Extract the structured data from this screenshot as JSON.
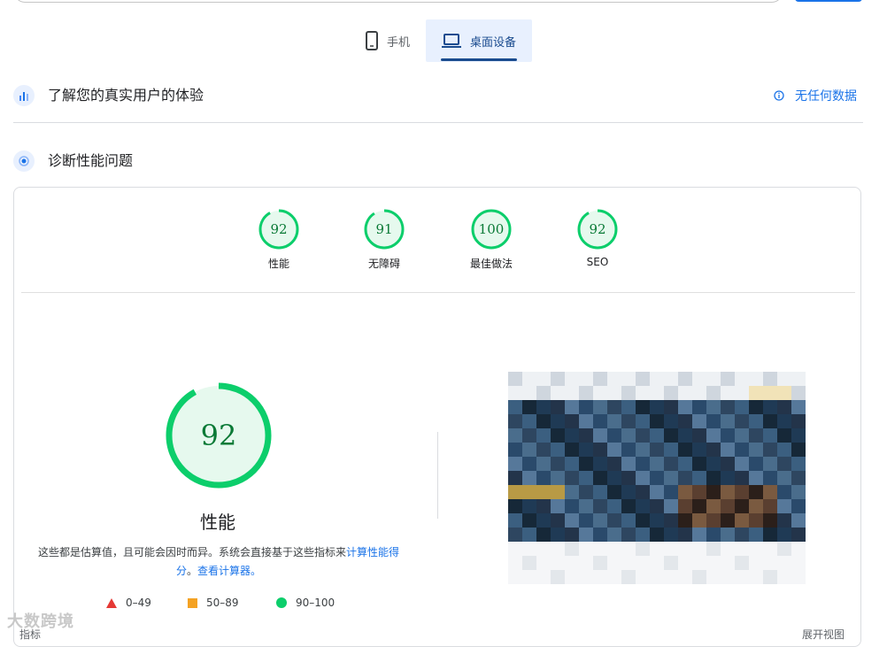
{
  "tabs": {
    "mobile": {
      "label": "手机",
      "icon": "smartphone-icon"
    },
    "desktop": {
      "label": "桌面设备",
      "icon": "laptop-icon"
    }
  },
  "crux": {
    "title": "了解您的真实用户的体验",
    "status": "无任何数据",
    "icon": "crux-chart-icon",
    "status_icon": "info-icon"
  },
  "diagnostics": {
    "title": "诊断性能问题",
    "icon": "lighthouse-icon"
  },
  "scores": [
    {
      "value": "92",
      "label": "性能"
    },
    {
      "value": "91",
      "label": "无障碍"
    },
    {
      "value": "100",
      "label": "最佳做法"
    },
    {
      "value": "92",
      "label": "SEO"
    }
  ],
  "performance": {
    "score": "92",
    "title": "性能",
    "desc_prefix": "这些都是估算值，且可能会因时而异。系统会直接基于这些指标来",
    "desc_link1": "计算性能得分",
    "desc_mid": "。",
    "desc_link2": "查看计算器。"
  },
  "legend": [
    {
      "range": "0–49",
      "shape": "triangle",
      "color": "#e53935"
    },
    {
      "range": "50–89",
      "shape": "square",
      "color": "#f4a223"
    },
    {
      "range": "90–100",
      "shape": "circle",
      "color": "#0cce6b"
    }
  ],
  "footer": {
    "metrics_cut": "指标",
    "expand_view": "展开视图"
  },
  "watermark": "大数跨境",
  "colors": {
    "pass": "#0cce6b",
    "pass_text": "#0a7a36",
    "accent": "#1a73e8",
    "tab_active_bg": "#e8f0fe"
  }
}
